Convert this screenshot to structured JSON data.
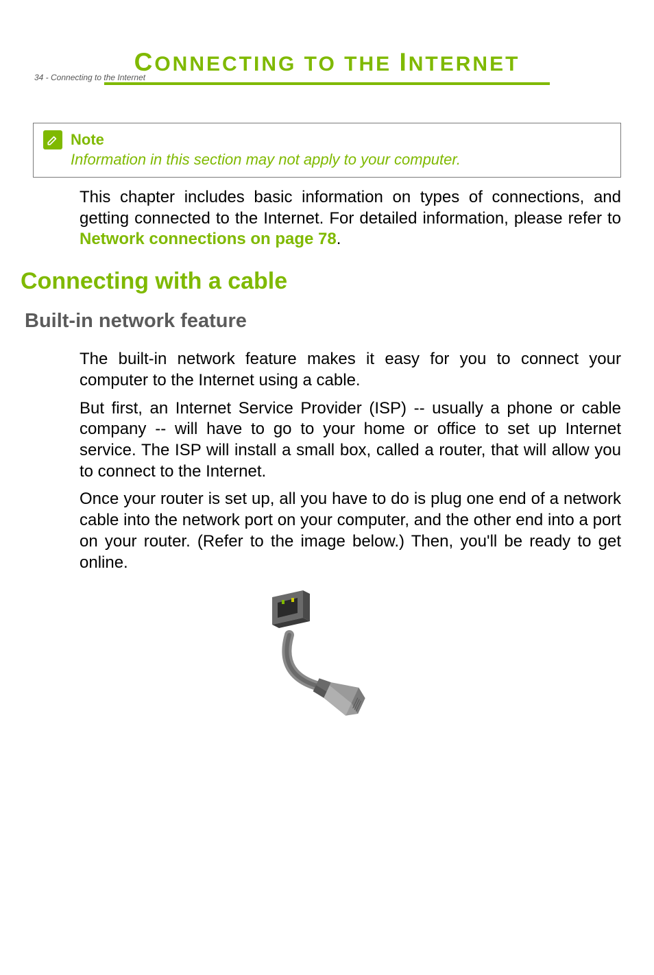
{
  "header": {
    "pageLine": "34 - Connecting to the Internet"
  },
  "chapter": {
    "firstCap": "C",
    "restFirstWord": "ONNECTING",
    "between": " TO THE ",
    "secondCap": "I",
    "restSecondWord": "NTERNET"
  },
  "note": {
    "label": "Note",
    "body": "Information in this section may not apply to your computer."
  },
  "intro": {
    "textStart": "This chapter includes basic information on types of connections, and getting connected to the Internet. For detailed information, please refer to ",
    "linkText": "Network connections on page 78",
    "textEnd": "."
  },
  "headings": {
    "h1": "Connecting with a cable",
    "h2": "Built-in network feature"
  },
  "paragraphs": {
    "p1": "The built-in network feature makes it easy for you to connect your computer to the Internet using a cable.",
    "p2": "But first, an Internet Service Provider (ISP) -- usually a phone or cable company -- will have to go to your home or office to set up Internet service. The ISP will install a small box, called a router, that will allow you to connect to the Internet.",
    "p3": "Once your router is set up, all you have to do is plug one end of a network cable into the network port on your computer, and the other end into a port on your router. (Refer to the image below.) Then, you'll be ready to get online."
  }
}
